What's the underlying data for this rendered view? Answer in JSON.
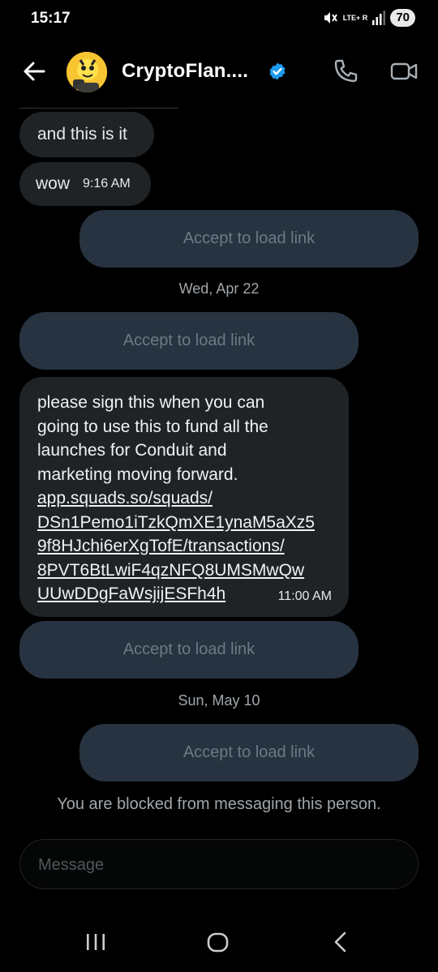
{
  "status": {
    "time": "15:17",
    "network": "LTE+ R",
    "battery": "70"
  },
  "header": {
    "contact_name": "CryptoFlan....",
    "verified": true,
    "icons": {
      "back": "arrow-left-icon",
      "call": "phone-icon",
      "video": "video-camera-icon",
      "verified": "verified-badge-icon"
    },
    "accent_color": "#1d9bf0"
  },
  "messages": [
    {
      "type": "incoming",
      "text": "and this is it"
    },
    {
      "type": "incoming",
      "text": "wow",
      "time": "9:16 AM"
    },
    {
      "type": "outgoing_link",
      "label": "Accept to load link"
    },
    {
      "type": "date_separator",
      "text": "Wed, Apr 22"
    },
    {
      "type": "incoming_link",
      "label": "Accept to load link"
    },
    {
      "type": "incoming",
      "text": "please sign this when you can\ngoing to use this to fund all the\nlaunches for Conduit and\nmarketing moving forward.",
      "link_lines": [
        "app.squads.so/squads/",
        "DSn1Pemo1iTzkQmXE1ynaM5aXz5",
        "9f8HJchi6erXgTofE/transactions/",
        "8PVT6BtLwiF4qzNFQ8UMSMwQw",
        "UUwDDgFaWsjijESFh4h"
      ],
      "time": "11:00 AM"
    },
    {
      "type": "incoming_link",
      "label": "Accept to load link"
    },
    {
      "type": "date_separator",
      "text": "Sun, May 10"
    },
    {
      "type": "outgoing_link",
      "label": "Accept to load link"
    }
  ],
  "blocked_notice": "You are blocked from messaging this person.",
  "composer": {
    "placeholder": "Message"
  },
  "nav": {
    "recents": "recents-icon",
    "home": "home-icon",
    "back": "back-chevron-icon"
  }
}
